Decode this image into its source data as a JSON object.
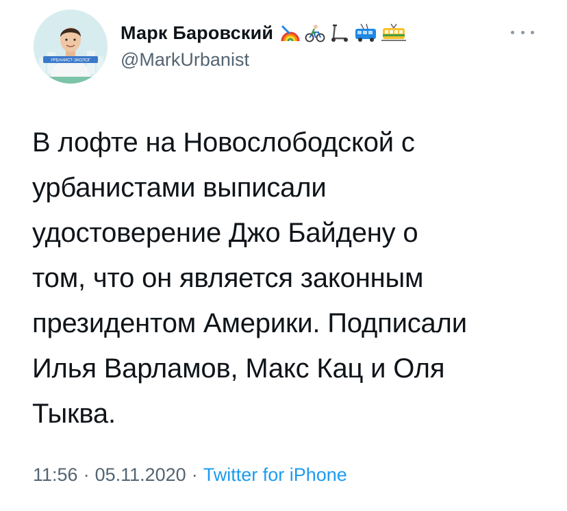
{
  "author": {
    "display_name": "Марк Баровский",
    "handle": "@MarkUrbanist",
    "avatar_badge_text": "УРБАНИСТ-ЭКОЛОГ",
    "name_emojis": [
      "rainbow-emoji",
      "cyclist-emoji",
      "kick-scooter-emoji",
      "trolleybus-emoji",
      "tram-emoji"
    ]
  },
  "tweet": {
    "text_lines": [
      "В лофте на Новослободской с",
      "урбанистами выписали",
      "удостоверение Джо Байдену о",
      "том, что он является законным",
      "президентом Америки. Подписали",
      "Илья Варламов, Макс Кац и Оля",
      "Тыква."
    ],
    "time": "11:56",
    "date": "05.11.2020",
    "separator": "·",
    "source": "Twitter for iPhone"
  },
  "colors": {
    "text": "#0f1419",
    "secondary": "#536471",
    "link": "#1d9bf0",
    "avatar_bg": "#cfe6ea",
    "badge_blue": "#3a78c9"
  }
}
